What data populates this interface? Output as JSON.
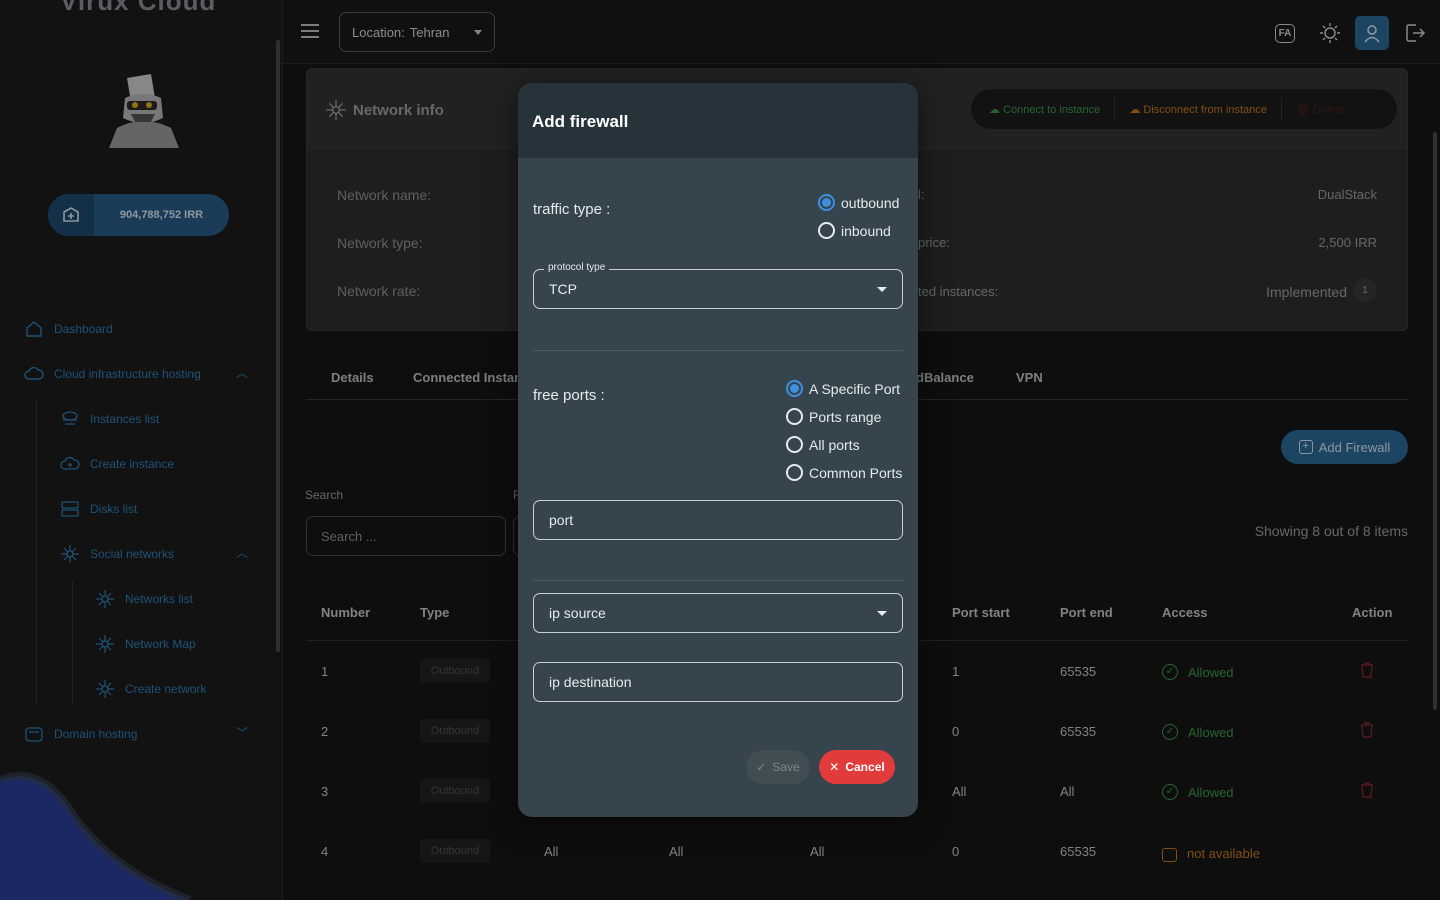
{
  "brand": "Virux Cloud",
  "wallet": {
    "balance": "904,788,752 IRR"
  },
  "sidebar": {
    "dashboard": "Dashboard",
    "cloud_hosting": "Cloud infrastructure hosting",
    "instances_list": "Instances list",
    "create_instance": "Create instance",
    "disks_list": "Disks list",
    "social_networks": "Social networks",
    "networks_list": "Networks list",
    "network_map": "Network Map",
    "create_network": "Create network",
    "domain_hosting": "Domain hosting"
  },
  "topbar": {
    "location_label": "Location:",
    "location_value": "Tehran",
    "lang": "FA"
  },
  "info": {
    "title": "Network info",
    "connect": "Connect to instance",
    "disconnect": "Disconnect from instance",
    "delete": "Delete",
    "network_name_label": "Network name:",
    "network_type_label": "Network type:",
    "network_rate_label": "Network rate:",
    "r1_label_partial": "l:",
    "r1_value": "DualStack",
    "r2_label_partial": "price:",
    "r2_value": "2,500 IRR",
    "r3_label_partial": "ted instances:",
    "r3_value": "Implemented",
    "r3_count": "1"
  },
  "tabs": {
    "details": "Details",
    "connected": "Connected Instan",
    "loadbalance": "dBalance",
    "vpn": "VPN"
  },
  "add_firewall_button": "Add Firewall",
  "search": {
    "label": "Search",
    "label2": "F",
    "placeholder": "Search ..."
  },
  "showing": "Showing 8 out of 8 items",
  "table": {
    "headers": {
      "number": "Number",
      "type": "Type",
      "port_start": "Port start",
      "port_end": "Port end",
      "access": "Access",
      "action": "Action"
    },
    "rows": [
      {
        "number": "1",
        "type": "Outbound",
        "c1": "",
        "c2": "",
        "c3": "",
        "port_start": "1",
        "port_end": "65535",
        "access": "Allowed"
      },
      {
        "number": "2",
        "type": "Outbound",
        "c1": "",
        "c2": "",
        "c3": "",
        "port_start": "0",
        "port_end": "65535",
        "access": "Allowed"
      },
      {
        "number": "3",
        "type": "Outbound",
        "c1": "",
        "c2": "",
        "c3": "",
        "port_start": "All",
        "port_end": "All",
        "access": "Allowed"
      },
      {
        "number": "4",
        "type": "Outbound",
        "c1": "All",
        "c2": "All",
        "c3": "All",
        "port_start": "0",
        "port_end": "65535",
        "access": "not available"
      }
    ]
  },
  "modal": {
    "title": "Add firewall",
    "traffic_label": "traffic type :",
    "traffic_options": [
      "outbound",
      "inbound"
    ],
    "protocol_legend": "protocol type",
    "protocol_value": "TCP",
    "ports_label": "free ports :",
    "port_options": [
      "A Specific Port",
      "Ports range",
      "All ports",
      "Common Ports"
    ],
    "port_placeholder": "port",
    "ip_source_placeholder": "ip source",
    "ip_destination_placeholder": "ip destination",
    "save": "Save",
    "cancel": "Cancel"
  }
}
